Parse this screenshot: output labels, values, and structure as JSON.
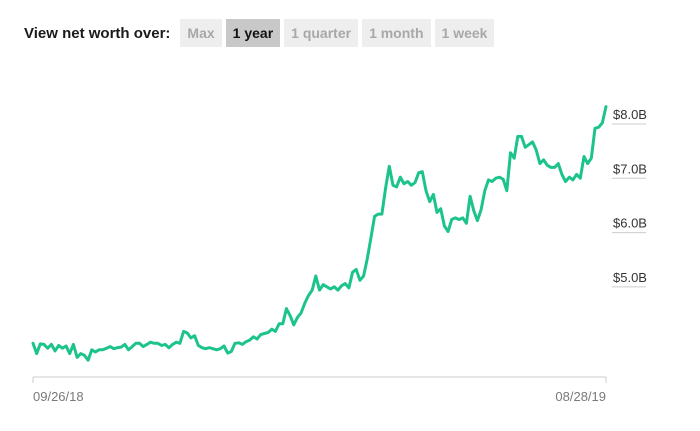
{
  "toolbar": {
    "label": "View net worth over:",
    "ranges": [
      "Max",
      "1 year",
      "1 quarter",
      "1 month",
      "1 week"
    ],
    "active": "1 year"
  },
  "colors": {
    "line": "#1cc48b",
    "axis": "#cccccc",
    "active_bg": "#c8c8c8",
    "inactive_bg": "#eeeeee"
  },
  "chart_data": {
    "type": "line",
    "title": "",
    "xlabel": "",
    "ylabel": "",
    "x_tick_labels": [
      "09/26/18",
      "08/28/19"
    ],
    "y_tick_values": [
      5.0,
      6.0,
      7.0,
      8.0
    ],
    "y_tick_labels": [
      "$5.0B",
      "$6.0B",
      "$7.0B",
      "$8.0B"
    ],
    "ylim": [
      3.3,
      8.1
    ],
    "series": [
      {
        "values": [
          3.74,
          3.55,
          3.73,
          3.72,
          3.65,
          3.72,
          3.6,
          3.7,
          3.65,
          3.69,
          3.55,
          3.72,
          3.48,
          3.55,
          3.52,
          3.43,
          3.62,
          3.58,
          3.62,
          3.62,
          3.65,
          3.68,
          3.64,
          3.66,
          3.67,
          3.72,
          3.62,
          3.68,
          3.74,
          3.74,
          3.68,
          3.72,
          3.76,
          3.74,
          3.74,
          3.7,
          3.72,
          3.66,
          3.72,
          3.76,
          3.74,
          3.96,
          3.93,
          3.84,
          3.88,
          3.7,
          3.66,
          3.64,
          3.66,
          3.64,
          3.62,
          3.64,
          3.69,
          3.56,
          3.59,
          3.74,
          3.75,
          3.72,
          3.77,
          3.8,
          3.86,
          3.82,
          3.9,
          3.92,
          3.94,
          4.0,
          3.96,
          4.1,
          4.1,
          4.38,
          4.25,
          4.08,
          4.22,
          4.3,
          4.48,
          4.62,
          4.72,
          4.98,
          4.72,
          4.82,
          4.78,
          4.74,
          4.78,
          4.72,
          4.8,
          4.84,
          4.76,
          5.05,
          5.1,
          4.9,
          4.98,
          5.3,
          5.68,
          6.08,
          6.12,
          6.12,
          6.6,
          7.0,
          6.65,
          6.62,
          6.8,
          6.68,
          6.72,
          6.65,
          6.7,
          6.88,
          6.9,
          6.55,
          6.35,
          6.48,
          6.15,
          6.22,
          5.9,
          5.8,
          6.02,
          6.05,
          6.02,
          6.05,
          5.95,
          6.45,
          6.18,
          6.0,
          6.2,
          6.55,
          6.75,
          6.72,
          6.78,
          6.8,
          6.76,
          6.55,
          7.25,
          7.15,
          7.55,
          7.55,
          7.35,
          7.4,
          7.45,
          7.3,
          7.05,
          7.12,
          7.02,
          6.98,
          6.98,
          7.05,
          6.85,
          6.72,
          6.8,
          6.75,
          6.85,
          6.78,
          7.18,
          7.05,
          7.15,
          7.7,
          7.72,
          7.8,
          8.1
        ]
      }
    ]
  }
}
